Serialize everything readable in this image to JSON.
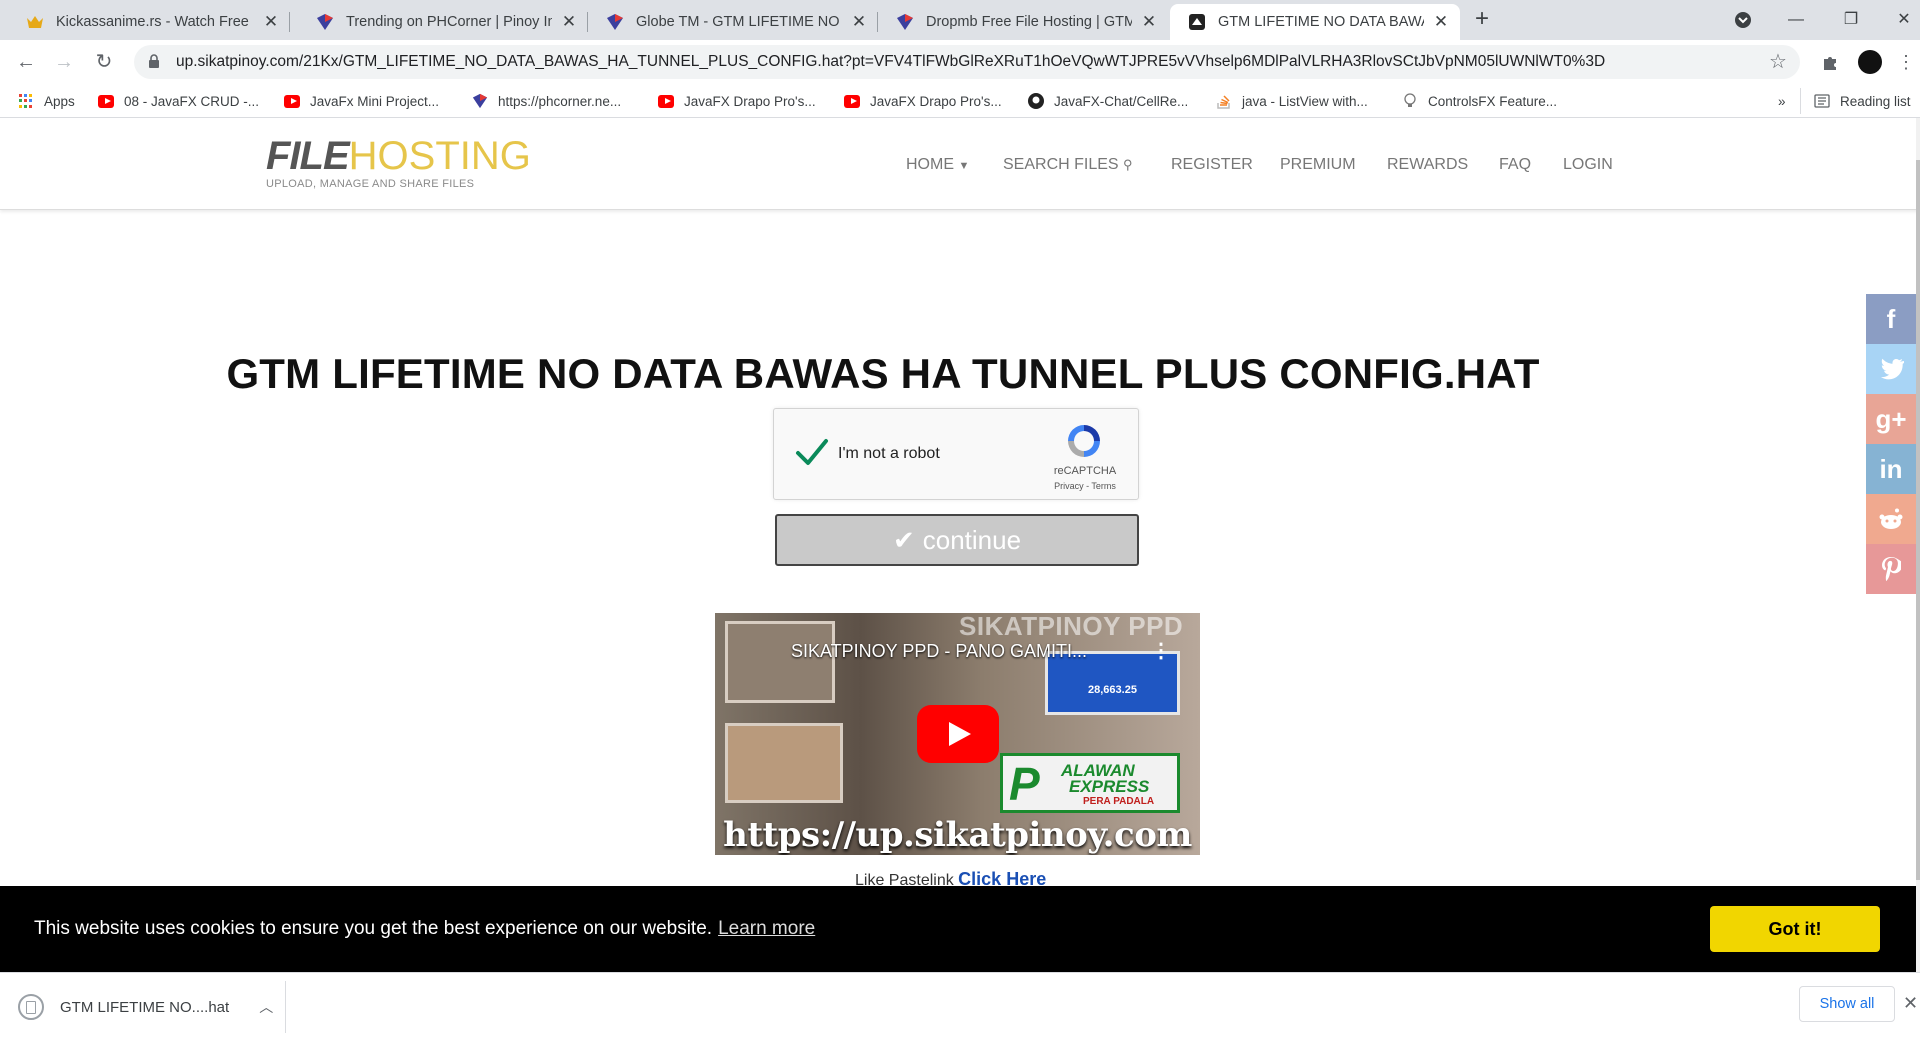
{
  "browser": {
    "tabs": [
      {
        "title": "Kickassanime.rs - Watch Free Pop",
        "icon": "crown-icon"
      },
      {
        "title": "Trending on PHCorner | Pinoy Int",
        "icon": "phcorner-icon"
      },
      {
        "title": "Globe TM - GTM LIFETIME NO D",
        "icon": "phcorner-icon"
      },
      {
        "title": "Dropmb Free File Hosting | GTM",
        "icon": "phcorner-icon"
      },
      {
        "title": "GTM LIFETIME NO DATA BAWAS",
        "icon": "site-icon",
        "active": true
      }
    ],
    "url": "up.sikatpinoy.com/21Kx/GTM_LIFETIME_NO_DATA_BAWAS_HA_TUNNEL_PLUS_CONFIG.hat?pt=VFV4TlFWbGlReXRuT1hOeVQwWTJPRE5vVVhselp6MDlPalVLRHA3RlovSCtJbVpNM05lUWNlWT0%3D",
    "bookmarks": [
      {
        "label": "Apps",
        "icon": "apps-grid-icon"
      },
      {
        "label": "08 - JavaFX CRUD -...",
        "icon": "youtube-icon"
      },
      {
        "label": "JavaFx Mini Project...",
        "icon": "youtube-icon"
      },
      {
        "label": "https://phcorner.ne...",
        "icon": "phcorner-icon"
      },
      {
        "label": "JavaFX Drapo Pro's...",
        "icon": "youtube-icon"
      },
      {
        "label": "JavaFX Drapo Pro's...",
        "icon": "youtube-icon"
      },
      {
        "label": "JavaFX-Chat/CellRe...",
        "icon": "github-icon"
      },
      {
        "label": "java - ListView with...",
        "icon": "stackoverflow-icon"
      },
      {
        "label": "ControlsFX Feature...",
        "icon": "lightbulb-icon"
      }
    ],
    "bookmarks_more": "»",
    "reading_list": "Reading list"
  },
  "site": {
    "logo_bold": "FILE",
    "logo_light": "HOSTING",
    "logo_tagline": "UPLOAD, MANAGE AND SHARE FILES",
    "nav": {
      "home": "HOME",
      "search": "SEARCH FILES",
      "register": "REGISTER",
      "premium": "PREMIUM",
      "rewards": "REWARDS",
      "faq": "FAQ",
      "login": "LOGIN"
    }
  },
  "main": {
    "title": "GTM LIFETIME NO DATA BAWAS HA TUNNEL PLUS CONFIG.HAT",
    "recaptcha": {
      "label": "I'm not a robot",
      "brand": "reCAPTCHA",
      "links": "Privacy - Terms",
      "checked": true
    },
    "continue_label": "continue",
    "video": {
      "title": "SIKATPINOY PPD - PANO GAMITI...",
      "watermark": "SIKATPINOY PPD",
      "url_text": "https://up.sikatpinoy.com",
      "balance": "28,663.25",
      "brand_line1": "ALAWAN",
      "brand_line2": "EXPRESS",
      "brand_line3": "PERA PADALA"
    },
    "pastelink_text": "Like Pastelink",
    "pastelink_link": "Click Here"
  },
  "social": [
    {
      "name": "facebook",
      "glyph": "f",
      "color": "#3b5998"
    },
    {
      "name": "twitter",
      "glyph": "t",
      "color": "#55acee"
    },
    {
      "name": "google-plus",
      "glyph": "g+",
      "color": "#dd4b39"
    },
    {
      "name": "linkedin",
      "glyph": "in",
      "color": "#0077b5"
    },
    {
      "name": "reddit",
      "glyph": "r",
      "color": "#ff4500"
    },
    {
      "name": "pinterest",
      "glyph": "p",
      "color": "#cb2027"
    }
  ],
  "cookie": {
    "message": "This website uses cookies to ensure you get the best experience on our website.",
    "learn_more": "Learn more",
    "accept": "Got it!"
  },
  "downloads": {
    "file": "GTM LIFETIME NO....hat",
    "show_all": "Show all"
  }
}
